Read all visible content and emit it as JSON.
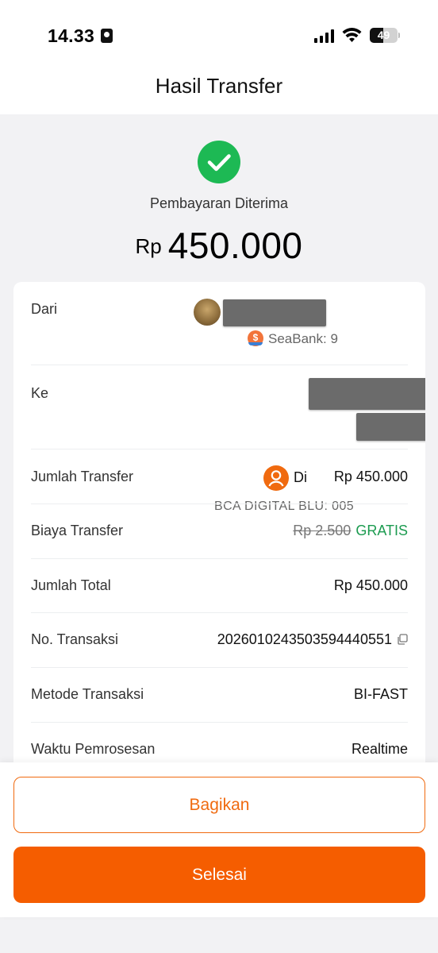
{
  "status_bar": {
    "time": "14.33",
    "battery": "49",
    "battery_level": 0.49
  },
  "header": {
    "title": "Hasil Transfer"
  },
  "result": {
    "status": "Pembayaran Diterima",
    "currency": "Rp",
    "amount": "450.000"
  },
  "details": {
    "dari": {
      "label": "Dari",
      "bank": "SeaBank: 9"
    },
    "ke": {
      "label": "Ke",
      "name_visible": "Di",
      "bank": "BCA DIGITAL BLU: 005"
    },
    "jumlah_transfer": {
      "label": "Jumlah Transfer",
      "value": "Rp 450.000"
    },
    "biaya_transfer": {
      "label": "Biaya Transfer",
      "old_value": "Rp 2.500",
      "value": "GRATIS"
    },
    "jumlah_total": {
      "label": "Jumlah Total",
      "value": "Rp 450.000"
    },
    "no_transaksi": {
      "label": "No. Transaksi",
      "value": "20260102435035944405​51"
    },
    "metode": {
      "label": "Metode Transaksi",
      "value": "BI-FAST"
    },
    "waktu": {
      "label": "Waktu Pemrosesan",
      "value": "Realtime"
    }
  },
  "actions": {
    "share_label": "Bagikan",
    "done_label": "Selesai"
  },
  "colors": {
    "accent": "#f55d00",
    "success": "#1db954",
    "gratis": "#1c9b50"
  }
}
